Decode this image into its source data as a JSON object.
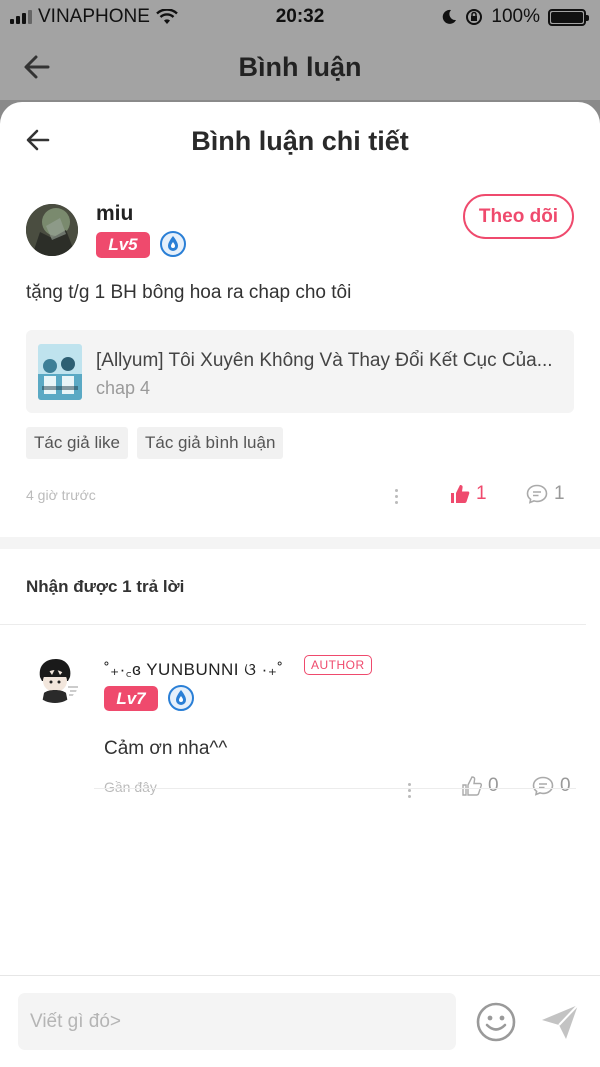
{
  "status_bar": {
    "carrier": "VINAPHONE",
    "time": "20:32",
    "battery": "100%",
    "battery_level": 1.0
  },
  "background_nav": {
    "title": "Bình luận"
  },
  "sheet": {
    "title": "Bình luận chi tiết"
  },
  "comment": {
    "username": "miu",
    "level": "Lv5",
    "follow_label": "Theo dõi",
    "text": "tặng t/g 1 BH bông hoa ra chap cho tôi",
    "chapter": {
      "title": "[Allyum] Tôi Xuyên Không Và Thay Đổi Kết Cục Của...",
      "subtitle": "chap 4"
    },
    "tags": [
      "Tác giả like",
      "Tác giả bình luận"
    ],
    "time": "4 giờ trước",
    "likes": "1",
    "replies": "1"
  },
  "replies_section": {
    "heading": "Nhận được 1 trả lời",
    "items": [
      {
        "username": "˚₊·꜀ɞ YUNBUNNI ଓ ·₊˚",
        "author_tag": "AUTHOR",
        "level": "Lv7",
        "text": "Cảm ơn nha^^",
        "time": "Gần đây",
        "likes": "0",
        "replies": "0"
      }
    ]
  },
  "input": {
    "placeholder": "Viết gì đó>"
  },
  "colors": {
    "accent": "#ef4a6d",
    "rank_badge": "#2a7fd6"
  }
}
